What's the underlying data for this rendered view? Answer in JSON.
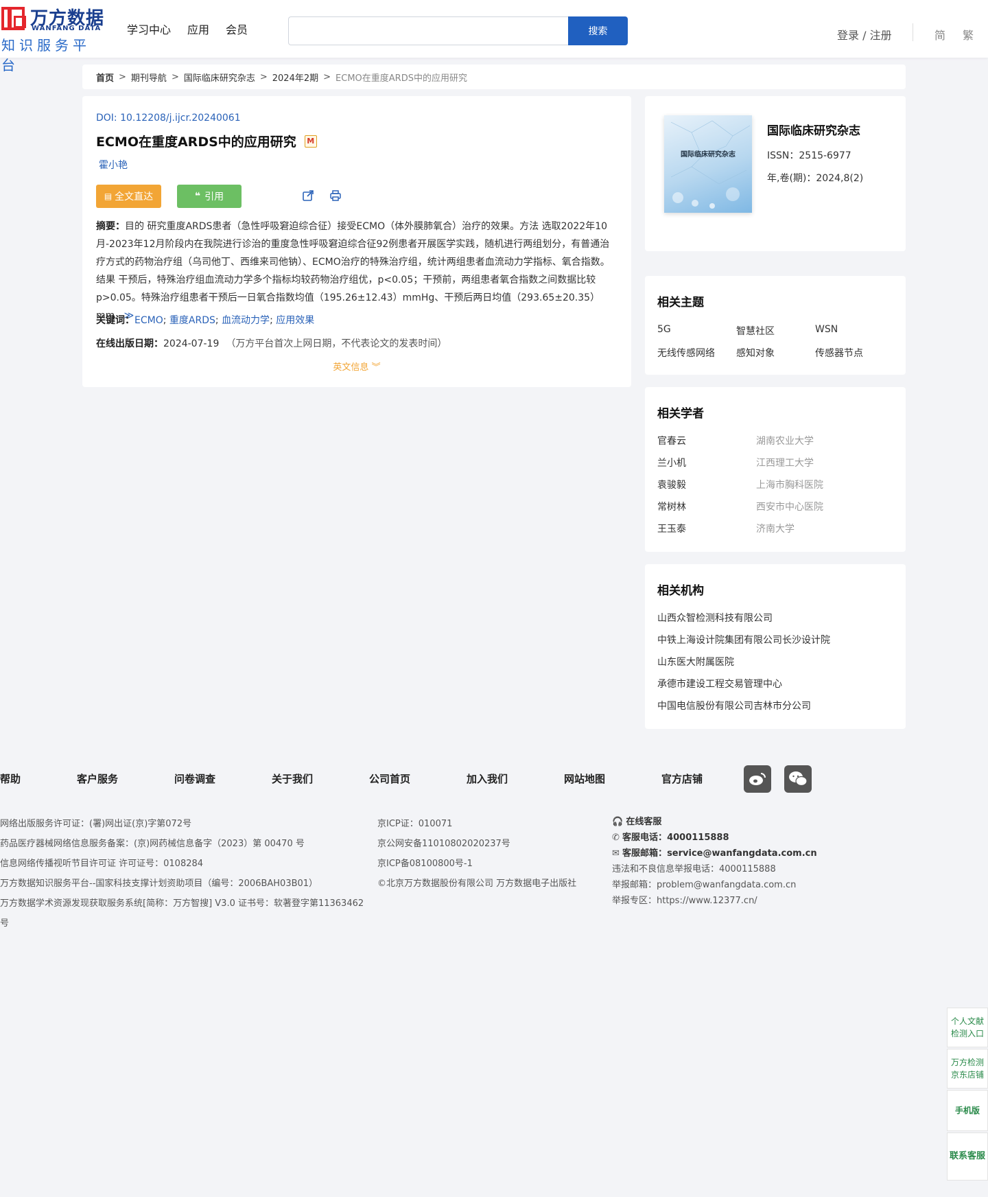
{
  "header": {
    "logo_cn": "万方数据",
    "logo_en": "WANFANG DATA",
    "logo_sub": "知识服务平台",
    "nav": [
      "学习中心",
      "应用",
      "会员"
    ],
    "search_placeholder": "",
    "search_button": "搜索",
    "login": "登录 / 注册",
    "lang_simplified": "简",
    "lang_traditional": "繁"
  },
  "breadcrumb": [
    "首页",
    "期刊导航",
    "国际临床研究杂志",
    "2024年2期",
    "ECMO在重度ARDS中的应用研究"
  ],
  "article": {
    "doi_label": "DOI: ",
    "doi": "10.12208/j.ijcr.20240061",
    "title": "ECMO在重度ARDS中的应用研究",
    "m_badge": "M",
    "author": "霍小艳",
    "btn_full": "全文直达",
    "btn_cite": "引用",
    "abstract_label": "摘要：",
    "abstract": "目的 研究重度ARDS患者（急性呼吸窘迫综合征）接受ECMO（体外膜肺氧合）治疗的效果。方法 选取2022年10月-2023年12月阶段内在我院进行诊治的重度急性呼吸窘迫综合征92例患者开展医学实践，随机进行两组划分，有普通治疗方式的药物治疗组（乌司他丁、西维来司他钠）、ECMO治疗的特殊治疗组，统计两组患者血流动力学指标、氧合指数。结果 干预后，特殊治疗组血流动力学多个指标均较药物治疗组优，p<0.05；干预前，两组患者氧合指数之间数据比较p>0.05。特殊治疗组患者干预后一日氧合指数均值（195.26±12.43）mmHg、干预后两日均值（293.65±20.35）mm...",
    "keywords_label": "关键词：",
    "keywords": [
      "ECMO",
      "重度ARDS",
      "血流动力学",
      "应用效果"
    ],
    "pubdate_label": "在线出版日期：",
    "pubdate": "2024-07-19",
    "pubdate_note": "（万方平台首次上网日期，不代表论文的发表时间）",
    "en_info": "英文信息"
  },
  "journal": {
    "cover_title": "国际临床研究杂志",
    "name": "国际临床研究杂志",
    "issn": "ISSN：2515-6977",
    "volume": "年,卷(期)：2024,8(2)"
  },
  "topics": {
    "title": "相关主题",
    "items": [
      "5G",
      "智慧社区",
      "WSN",
      "无线传感网络",
      "感知对象",
      "传感器节点"
    ]
  },
  "scholars": {
    "title": "相关学者",
    "items": [
      {
        "name": "官春云",
        "org": "湖南农业大学"
      },
      {
        "name": "兰小机",
        "org": "江西理工大学"
      },
      {
        "name": "袁骏毅",
        "org": "上海市胸科医院"
      },
      {
        "name": "常树林",
        "org": "西安市中心医院"
      },
      {
        "name": "王玉泰",
        "org": "济南大学"
      }
    ]
  },
  "orgs": {
    "title": "相关机构",
    "items": [
      "山西众智检测科技有限公司",
      "中铁上海设计院集团有限公司长沙设计院",
      "山东医大附属医院",
      "承德市建设工程交易管理中心",
      "中国电信股份有限公司吉林市分公司"
    ]
  },
  "footer": {
    "nav": [
      "帮助",
      "客户服务",
      "问卷调查",
      "关于我们",
      "公司首页",
      "加入我们",
      "网站地图",
      "官方店铺"
    ],
    "col1": [
      "网络出版服务许可证：(署)网出证(京)字第072号",
      "药品医疗器械网络信息服务备案：(京)网药械信息备字（2023）第 00470 号",
      "信息网络传播视听节目许可证 许可证号：0108284",
      "万方数据知识服务平台--国家科技支撑计划资助项目（编号：2006BAH03B01）",
      "万方数据学术资源发现获取服务系统[简称：万方智搜] V3.0 证书号：软著登字第11363462号"
    ],
    "col2": [
      "京ICP证：010071",
      "京公网安备11010802020237号",
      "京ICP备08100800号-1",
      "©北京万方数据股份有限公司 万方数据电子出版社"
    ],
    "col3": {
      "online": "在线客服",
      "phone_label": "客服电话：",
      "phone": "4000115888",
      "email_label": "客服邮箱：",
      "email": "service@wanfangdata.com.cn",
      "report_phone": "违法和不良信息举报电话：4000115888",
      "report_email": "举报邮箱：problem@wanfangdata.com.cn",
      "report_zone": "举报专区：https://www.12377.cn/"
    }
  },
  "side": [
    "个人文献检测入口",
    "万方检测京东店铺",
    "手机版",
    "联系客服"
  ]
}
